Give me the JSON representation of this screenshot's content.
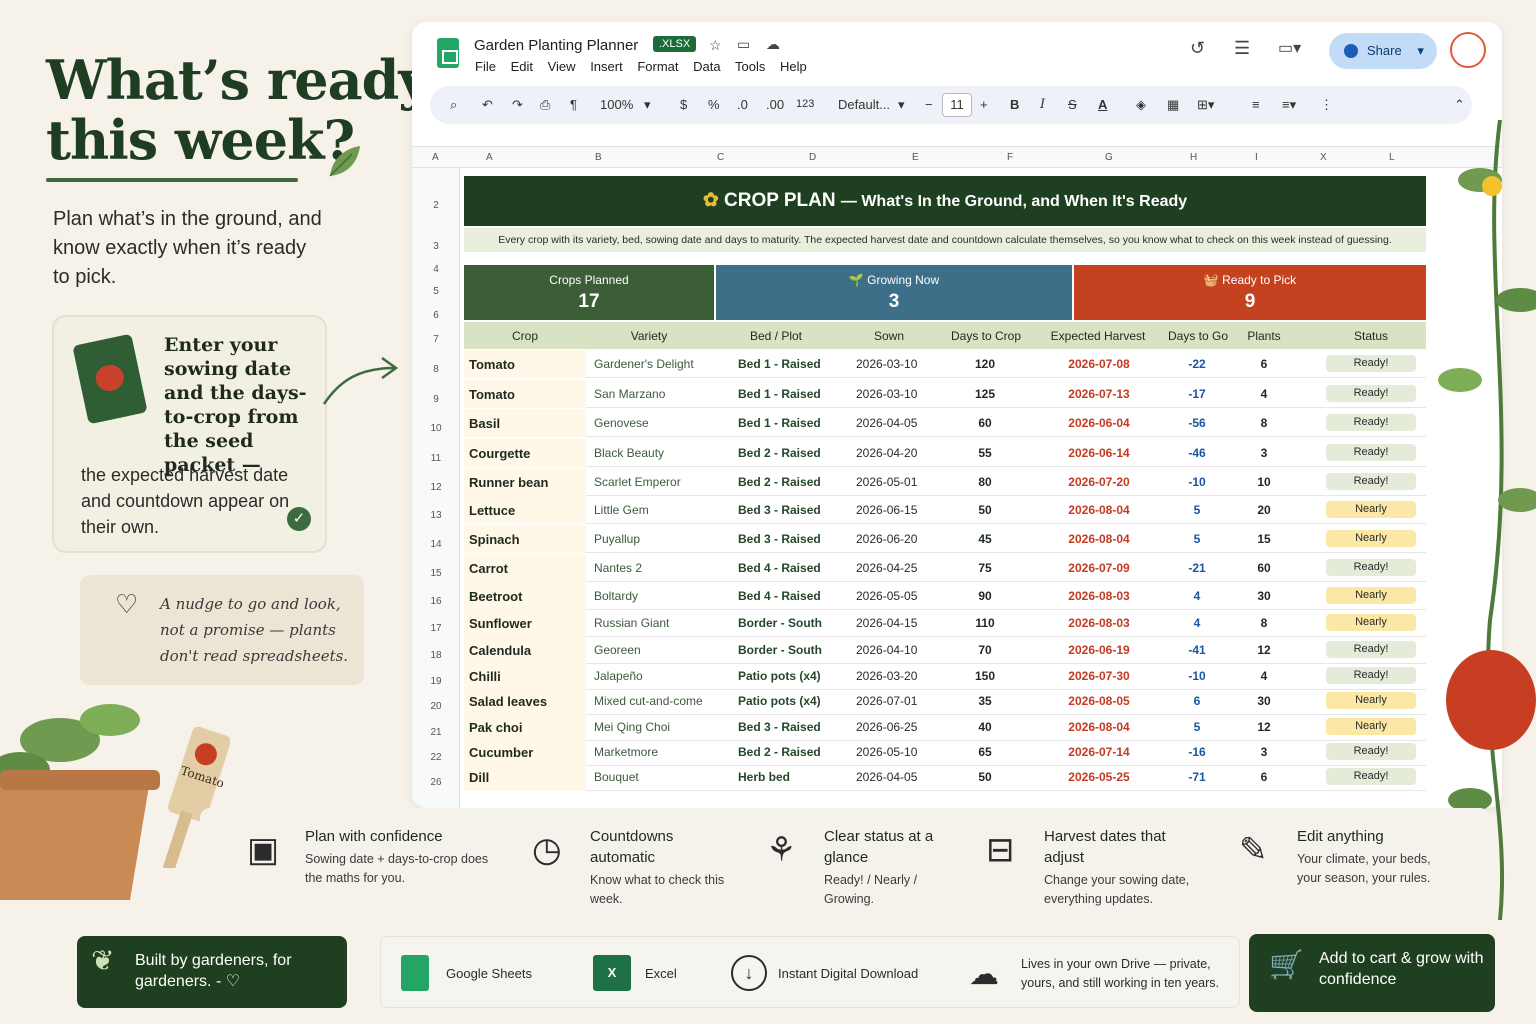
{
  "hero": {
    "title_line1": "What’s ready",
    "title_line2": "this week?",
    "subtitle": "Plan what’s in the ground, and know exactly when it’s ready to pick."
  },
  "seed_card": {
    "bold_text": "Enter your sowing date and the days-to-crop from the seed packet —",
    "rest_text": "the expected harvest date and countdown appear on their own."
  },
  "note_card": {
    "text": "A nudge to go and look, not a promise — plants don't read spreadsheets."
  },
  "plant_tag_label": "Tomato",
  "window": {
    "doc_title": "Garden Planting Planner",
    "file_badge": ".XLSX",
    "menu": [
      "File",
      "Edit",
      "View",
      "Insert",
      "Format",
      "Data",
      "Tools",
      "Help"
    ],
    "share_label": "Share"
  },
  "toolbar": {
    "zoom": "100%",
    "currency": "$",
    "percent": "%",
    "dec_down": ".0",
    "dec_up": ".00",
    "number_format": "123",
    "font": "Default...",
    "font_size": "11",
    "minus": "−",
    "plus": "+",
    "bold": "B",
    "italic": "I"
  },
  "column_headers": [
    "A",
    "A",
    "B",
    "C",
    "D",
    "E",
    "F",
    "G",
    "H",
    "I",
    "X",
    "L"
  ],
  "row_numbers": [
    "2",
    "3",
    "4",
    "5",
    "6",
    "7",
    "8",
    "9",
    "10",
    "11",
    "12",
    "13",
    "14",
    "15",
    "16",
    "17",
    "18",
    "19",
    "20",
    "21",
    "22",
    "26"
  ],
  "banner": {
    "title": "CROP PLAN",
    "subtitle": "— What's In the Ground, and When It's Ready",
    "description": "Every crop with its variety, bed, sowing date and days to maturity. The expected harvest date and countdown calculate themselves, so you know what to check on this week instead of guessing."
  },
  "kpis": [
    {
      "label": "Crops Planned",
      "value": "17",
      "color": "#3b5e36"
    },
    {
      "label": "🌱 Growing Now",
      "value": "3",
      "color": "#3e6f88"
    },
    {
      "label": "🧺 Ready to Pick",
      "value": "9",
      "color": "#c4421f"
    }
  ],
  "table_headers": [
    "Crop",
    "Variety",
    "Bed / Plot",
    "Sown",
    "Days to Crop",
    "Expected Harvest",
    "Days to Go",
    "Plants",
    "Status"
  ],
  "rows": [
    {
      "crop": "Tomato",
      "variety": "Gardener's Delight",
      "bed": "Bed 1 - Raised",
      "sown": "2026-03-10",
      "days": "120",
      "harvest": "2026-07-08",
      "to_go": "-22",
      "plants": "6",
      "status": "Ready!"
    },
    {
      "crop": "Tomato",
      "variety": "San Marzano",
      "bed": "Bed 1 - Raised",
      "sown": "2026-03-10",
      "days": "125",
      "harvest": "2026-07-13",
      "to_go": "-17",
      "plants": "4",
      "status": "Ready!"
    },
    {
      "crop": "Basil",
      "variety": "Genovese",
      "bed": "Bed 1 - Raised",
      "sown": "2026-04-05",
      "days": "60",
      "harvest": "2026-06-04",
      "to_go": "-56",
      "plants": "8",
      "status": "Ready!"
    },
    {
      "crop": "Courgette",
      "variety": "Black Beauty",
      "bed": "Bed 2 - Raised",
      "sown": "2026-04-20",
      "days": "55",
      "harvest": "2026-06-14",
      "to_go": "-46",
      "plants": "3",
      "status": "Ready!"
    },
    {
      "crop": "Runner bean",
      "variety": "Scarlet Emperor",
      "bed": "Bed 2 - Raised",
      "sown": "2026-05-01",
      "days": "80",
      "harvest": "2026-07-20",
      "to_go": "-10",
      "plants": "10",
      "status": "Ready!"
    },
    {
      "crop": "Lettuce",
      "variety": "Little Gem",
      "bed": "Bed 3 - Raised",
      "sown": "2026-06-15",
      "days": "50",
      "harvest": "2026-08-04",
      "to_go": "5",
      "plants": "20",
      "status": "Nearly"
    },
    {
      "crop": "Spinach",
      "variety": "Puyallup",
      "bed": "Bed 3 - Raised",
      "sown": "2026-06-20",
      "days": "45",
      "harvest": "2026-08-04",
      "to_go": "5",
      "plants": "15",
      "status": "Nearly"
    },
    {
      "crop": "Carrot",
      "variety": "Nantes 2",
      "bed": "Bed 4 - Raised",
      "sown": "2026-04-25",
      "days": "75",
      "harvest": "2026-07-09",
      "to_go": "-21",
      "plants": "60",
      "status": "Ready!"
    },
    {
      "crop": "Beetroot",
      "variety": "Boltardy",
      "bed": "Bed 4 - Raised",
      "sown": "2026-05-05",
      "days": "90",
      "harvest": "2026-08-03",
      "to_go": "4",
      "plants": "30",
      "status": "Nearly"
    },
    {
      "crop": "Sunflower",
      "variety": "Russian Giant",
      "bed": "Border - South",
      "sown": "2026-04-15",
      "days": "110",
      "harvest": "2026-08-03",
      "to_go": "4",
      "plants": "8",
      "status": "Nearly"
    },
    {
      "crop": "Calendula",
      "variety": "Georeen",
      "bed": "Border - South",
      "sown": "2026-04-10",
      "days": "70",
      "harvest": "2026-06-19",
      "to_go": "-41",
      "plants": "12",
      "status": "Ready!"
    },
    {
      "crop": "Chilli",
      "variety": "Jalapeño",
      "bed": "Patio pots (x4)",
      "sown": "2026-03-20",
      "days": "150",
      "harvest": "2026-07-30",
      "to_go": "-10",
      "plants": "4",
      "status": "Ready!"
    },
    {
      "crop": "Salad leaves",
      "variety": "Mixed cut-and-come",
      "bed": "Patio pots (x4)",
      "sown": "2026-07-01",
      "days": "35",
      "harvest": "2026-08-05",
      "to_go": "6",
      "plants": "30",
      "status": "Nearly"
    },
    {
      "crop": "Pak choi",
      "variety": "Mei Qing Choi",
      "bed": "Bed 3 - Raised",
      "sown": "2026-06-25",
      "days": "40",
      "harvest": "2026-08-04",
      "to_go": "5",
      "plants": "12",
      "status": "Nearly"
    },
    {
      "crop": "Cucumber",
      "variety": "Marketmore",
      "bed": "Bed 2 - Raised",
      "sown": "2026-05-10",
      "days": "65",
      "harvest": "2026-07-14",
      "to_go": "-16",
      "plants": "3",
      "status": "Ready!"
    },
    {
      "crop": "Dill",
      "variety": "Bouquet",
      "bed": "Herb bed",
      "sown": "2026-04-05",
      "days": "50",
      "harvest": "2026-05-25",
      "to_go": "-71",
      "plants": "6",
      "status": "Ready!"
    }
  ],
  "features": [
    {
      "title": "Plan with confidence",
      "desc": "Sowing date + days-to-crop does the maths for you.",
      "icon": "calendar-check-icon"
    },
    {
      "title": "Countdowns automatic",
      "desc": "Know what to check this week.",
      "icon": "clock-icon"
    },
    {
      "title": "Clear status at a glance",
      "desc": "Ready! / Nearly / Growing.",
      "icon": "seedling-icon"
    },
    {
      "title": "Harvest dates that adjust",
      "desc": "Change your sowing date, everything updates.",
      "icon": "basket-icon"
    },
    {
      "title": "Edit anything",
      "desc": "Your climate, your beds, your season, your rules.",
      "icon": "pencil-icon"
    }
  ],
  "bottom": {
    "built_by": "Built by gardeners, for gardeners. - ♡",
    "google_sheets": "Google Sheets",
    "excel": "Excel",
    "download": "Instant Digital Download",
    "drive": "Lives in your own Drive — private, yours, and still working in ten years.",
    "cta": "Add to cart & grow with confidence"
  }
}
